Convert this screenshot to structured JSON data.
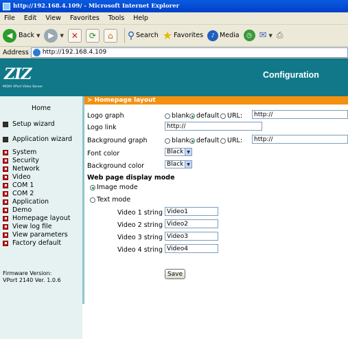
{
  "window": {
    "title": "http://192.168.4.109/ - Microsoft Internet Explorer"
  },
  "menu": [
    "File",
    "Edit",
    "View",
    "Favorites",
    "Tools",
    "Help"
  ],
  "toolbar": {
    "back": "Back",
    "search": "Search",
    "favorites": "Favorites",
    "media": "Media"
  },
  "address": {
    "label": "Address",
    "url": "http://192.168.4.109"
  },
  "banner": {
    "logo": "ZIZ",
    "logo_sub": "MOXA VPort Video Server",
    "heading": "Configuration",
    "color": "#107888"
  },
  "sidebar": {
    "home": "Home",
    "wizards": [
      "Setup wizard",
      "Application wizard"
    ],
    "items": [
      "System",
      "Security",
      "Network",
      "Video",
      "COM 1",
      "COM 2",
      "Application",
      "Demo",
      "Homepage layout",
      "View log file",
      "View parameters",
      "Factory default"
    ],
    "firmware_label": "Firmware Version:",
    "firmware_value": "VPort 2140 Ver. 1.0.6"
  },
  "section_title": "> Homepage layout",
  "form": {
    "logo_graph": {
      "label": "Logo graph",
      "opt_blank": "blank",
      "opt_default": "default",
      "opt_url": "URL:",
      "value": "http://"
    },
    "logo_link": {
      "label": "Logo link",
      "value": "http://"
    },
    "background_graph": {
      "label": "Background graph",
      "opt_blank": "blank",
      "opt_default": "default",
      "opt_url": "URL:",
      "value": "http://"
    },
    "font_color": {
      "label": "Font color",
      "value": "Black"
    },
    "background_color": {
      "label": "Background color",
      "value": "Black"
    },
    "display_mode": {
      "title": "Web page display mode",
      "image_mode": "Image mode",
      "text_mode": "Text mode",
      "selected": "Image mode"
    },
    "video_strings": [
      {
        "label": "Video 1 string",
        "value": "Video1"
      },
      {
        "label": "Video 2 string",
        "value": "Video2"
      },
      {
        "label": "Video 3 string",
        "value": "Video3"
      },
      {
        "label": "Video 4 string",
        "value": "Video4"
      }
    ],
    "save": "Save"
  },
  "colors": {
    "accent_orange": "#f49010",
    "sidebar_bg": "#e6f2f2",
    "bullet_red": "#c61818"
  }
}
